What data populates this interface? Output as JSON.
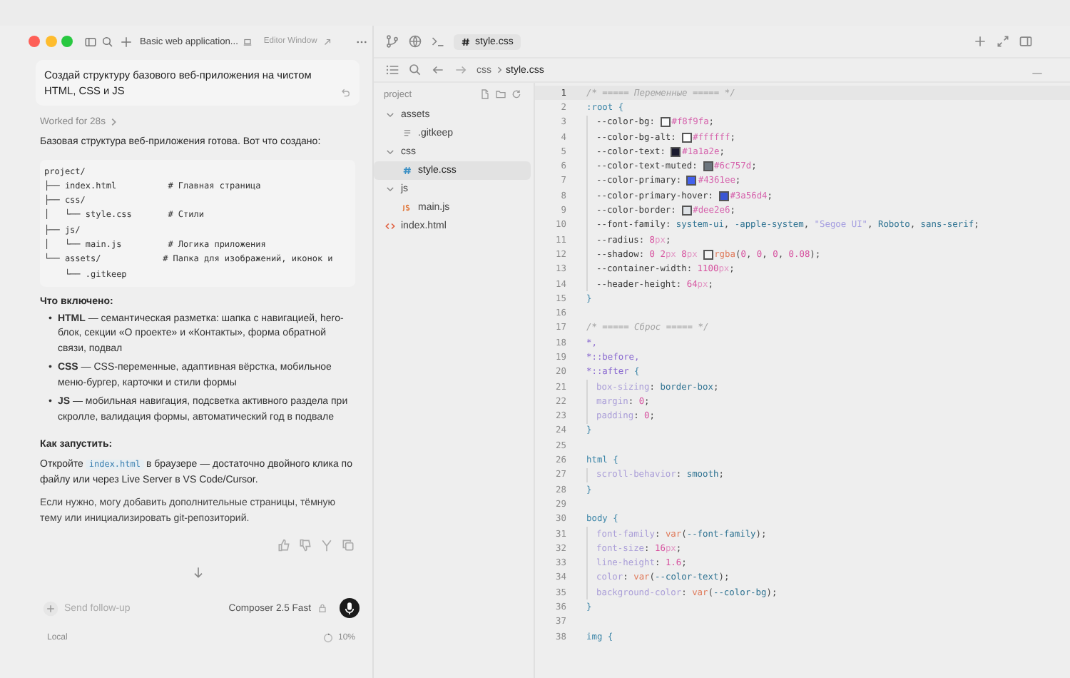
{
  "title_bar": {
    "title": "Basic web application...",
    "editor_window": "Editor Window"
  },
  "chat": {
    "user_message": "Создай структуру базового веб-приложения на чистом HTML, CSS и JS",
    "worked": "Worked for 28s",
    "intro": "Базовая структура веб-приложения готова. Вот что создано:",
    "code_block": [
      "project/",
      "├── index.html          # Главная страница",
      "├── css/",
      "│   └── style.css       # Стили",
      "├── js/",
      "│   └── main.js         # Логика приложения",
      "└── assets/            # Папка для изображений, иконок и",
      "    └── .gitkeep"
    ],
    "included_heading": "Что включено:",
    "bullets": [
      {
        "marker": "•",
        "text": "**HTML** — семантическая разметка: шапка с навигацией, hero-блок, секции «О проекте» и «Контакты», форма обратной связи, подвал"
      },
      {
        "marker": "•",
        "text": "**CSS** — CSS-переменные, адаптивная вёрстка, мобильное меню-бургер, карточки и стили формы"
      },
      {
        "marker": "•",
        "text": "**JS** — мобильная навигация, подсветка активного раздела при скролле, валидация формы, автоматический год в подвале"
      }
    ],
    "run_heading": "Как запустить:",
    "run_text": {
      "before": "Откройте",
      "code": "index.html",
      "after": "в браузере — достаточно двойного клика по файлу или через Live Server в VS Code/Cursor."
    },
    "closing": "Если нужно, могу добавить дополнительные страницы, тёмную тему или инициализировать git-репозиторий.",
    "input": {
      "placeholder": "Send follow-up"
    },
    "model": "Composer 2.5 Fast",
    "footer_left": "Local",
    "context": "10%"
  },
  "editor": {
    "tab": {
      "label": "style.css",
      "selected": true
    },
    "breadcrumb": [
      "css",
      "style.css"
    ],
    "file_tree": {
      "title": "project",
      "items": [
        {
          "label": "assets",
          "kind": "folder",
          "expanded": true,
          "selected": false,
          "children": [
            {
              "label": ".gitkeep",
              "kind": "text",
              "selected": false
            }
          ]
        },
        {
          "label": "css",
          "kind": "folder",
          "expanded": true,
          "selected": false,
          "children": [
            {
              "label": "style.css",
              "kind": "css",
              "selected": true
            }
          ]
        },
        {
          "label": "js",
          "kind": "folder",
          "expanded": true,
          "selected": false,
          "children": [
            {
              "label": "main.js",
              "kind": "js",
              "selected": false
            }
          ]
        },
        {
          "label": "index.html",
          "kind": "html",
          "selected": false
        }
      ]
    },
    "lines": [
      {
        "n": "1",
        "selected": true,
        "guide": false,
        "tokens": [
          {
            "kind": "comment",
            "text": "/* ===== Переменные ===== */"
          }
        ]
      },
      {
        "n": "2",
        "selected": false,
        "guide": false,
        "tokens": [
          {
            "kind": "tag",
            "text": ":root"
          },
          {
            "kind": "brace",
            "text": " {"
          }
        ]
      },
      {
        "n": "3",
        "selected": false,
        "guide": true,
        "tokens": [
          {
            "kind": "property",
            "text": "--color-bg"
          },
          {
            "kind": "punct",
            "text": ": "
          },
          {
            "kind": "swatch",
            "color": "#f8f9fa"
          },
          {
            "kind": "hex",
            "text": "#f8f9fa"
          },
          {
            "kind": "punct",
            "text": ";"
          }
        ]
      },
      {
        "n": "4",
        "selected": false,
        "guide": true,
        "tokens": [
          {
            "kind": "property",
            "text": "--color-bg-alt"
          },
          {
            "kind": "punct",
            "text": ": "
          },
          {
            "kind": "swatch",
            "color": "#ffffff"
          },
          {
            "kind": "hex",
            "text": "#ffffff"
          },
          {
            "kind": "punct",
            "text": ";"
          }
        ]
      },
      {
        "n": "5",
        "selected": false,
        "guide": true,
        "tokens": [
          {
            "kind": "property",
            "text": "--color-text"
          },
          {
            "kind": "punct",
            "text": ": "
          },
          {
            "kind": "swatch",
            "color": "#1a1a2e"
          },
          {
            "kind": "hex",
            "text": "#1a1a2e"
          },
          {
            "kind": "punct",
            "text": ";"
          }
        ]
      },
      {
        "n": "6",
        "selected": false,
        "guide": true,
        "tokens": [
          {
            "kind": "property",
            "text": "--color-text-muted"
          },
          {
            "kind": "punct",
            "text": ": "
          },
          {
            "kind": "swatch",
            "color": "#6c757d"
          },
          {
            "kind": "hex",
            "text": "#6c757d"
          },
          {
            "kind": "punct",
            "text": ";"
          }
        ]
      },
      {
        "n": "7",
        "selected": false,
        "guide": true,
        "tokens": [
          {
            "kind": "property",
            "text": "--color-primary"
          },
          {
            "kind": "punct",
            "text": ": "
          },
          {
            "kind": "swatch",
            "color": "#4361ee"
          },
          {
            "kind": "hex",
            "text": "#4361ee"
          },
          {
            "kind": "punct",
            "text": ";"
          }
        ]
      },
      {
        "n": "8",
        "selected": false,
        "guide": true,
        "tokens": [
          {
            "kind": "property",
            "text": "--color-primary-hover"
          },
          {
            "kind": "punct",
            "text": ": "
          },
          {
            "kind": "swatch",
            "color": "#3a56d4"
          },
          {
            "kind": "hex",
            "text": "#3a56d4"
          },
          {
            "kind": "punct",
            "text": ";"
          }
        ]
      },
      {
        "n": "9",
        "selected": false,
        "guide": true,
        "tokens": [
          {
            "kind": "property",
            "text": "--color-border"
          },
          {
            "kind": "punct",
            "text": ": "
          },
          {
            "kind": "swatch",
            "color": "#dee2e6"
          },
          {
            "kind": "hex",
            "text": "#dee2e6"
          },
          {
            "kind": "punct",
            "text": ";"
          }
        ]
      },
      {
        "n": "10",
        "selected": false,
        "guide": true,
        "tokens": [
          {
            "kind": "property",
            "text": "--font-family"
          },
          {
            "kind": "punct",
            "text": ": "
          },
          {
            "kind": "value",
            "text": "system-ui"
          },
          {
            "kind": "punct",
            "text": ", "
          },
          {
            "kind": "value",
            "text": "-apple-system"
          },
          {
            "kind": "punct",
            "text": ", "
          },
          {
            "kind": "string",
            "text": "\"Segoe UI\""
          },
          {
            "kind": "punct",
            "text": ", "
          },
          {
            "kind": "value",
            "text": "Roboto"
          },
          {
            "kind": "punct",
            "text": ", "
          },
          {
            "kind": "value",
            "text": "sans-serif"
          },
          {
            "kind": "punct",
            "text": ";"
          }
        ]
      },
      {
        "n": "11",
        "selected": false,
        "guide": true,
        "tokens": [
          {
            "kind": "property",
            "text": "--radius"
          },
          {
            "kind": "punct",
            "text": ": "
          },
          {
            "kind": "number",
            "text": "8"
          },
          {
            "kind": "unit",
            "text": "px"
          },
          {
            "kind": "punct",
            "text": ";"
          }
        ]
      },
      {
        "n": "12",
        "selected": false,
        "guide": true,
        "tokens": [
          {
            "kind": "property",
            "text": "--shadow"
          },
          {
            "kind": "punct",
            "text": ": "
          },
          {
            "kind": "number",
            "text": "0 2"
          },
          {
            "kind": "unit",
            "text": "px "
          },
          {
            "kind": "number",
            "text": "8"
          },
          {
            "kind": "unit",
            "text": "px "
          },
          {
            "kind": "swatch",
            "color": "#f4f4f4"
          },
          {
            "kind": "func",
            "text": "rgba"
          },
          {
            "kind": "punct",
            "text": "("
          },
          {
            "kind": "number",
            "text": "0"
          },
          {
            "kind": "punct",
            "text": ", "
          },
          {
            "kind": "number",
            "text": "0"
          },
          {
            "kind": "punct",
            "text": ", "
          },
          {
            "kind": "number",
            "text": "0"
          },
          {
            "kind": "punct",
            "text": ", "
          },
          {
            "kind": "number",
            "text": "0.08"
          },
          {
            "kind": "punct",
            "text": ");"
          }
        ]
      },
      {
        "n": "13",
        "selected": false,
        "guide": true,
        "tokens": [
          {
            "kind": "property",
            "text": "--container-width"
          },
          {
            "kind": "punct",
            "text": ": "
          },
          {
            "kind": "number",
            "text": "1100"
          },
          {
            "kind": "unit",
            "text": "px"
          },
          {
            "kind": "punct",
            "text": ";"
          }
        ]
      },
      {
        "n": "14",
        "selected": false,
        "guide": true,
        "tokens": [
          {
            "kind": "property",
            "text": "--header-height"
          },
          {
            "kind": "punct",
            "text": ": "
          },
          {
            "kind": "number",
            "text": "64"
          },
          {
            "kind": "unit",
            "text": "px"
          },
          {
            "kind": "punct",
            "text": ";"
          }
        ]
      },
      {
        "n": "15",
        "selected": false,
        "guide": false,
        "tokens": [
          {
            "kind": "brace",
            "text": "}"
          }
        ]
      },
      {
        "n": "16",
        "selected": false,
        "guide": false
      },
      {
        "n": "17",
        "selected": false,
        "guide": false,
        "tokens": [
          {
            "kind": "comment",
            "text": "/* ===== Сброс ===== */"
          }
        ]
      },
      {
        "n": "18",
        "selected": false,
        "guide": false,
        "tokens": [
          {
            "kind": "selector",
            "text": "*,"
          }
        ]
      },
      {
        "n": "19",
        "selected": false,
        "guide": false,
        "tokens": [
          {
            "kind": "selector",
            "text": "*::before,"
          }
        ]
      },
      {
        "n": "20",
        "selected": false,
        "guide": false,
        "tokens": [
          {
            "kind": "selector",
            "text": "*::after"
          },
          {
            "kind": "brace",
            "text": " {"
          }
        ]
      },
      {
        "n": "21",
        "selected": false,
        "guide": true,
        "tokens": [
          {
            "kind": "prop2",
            "text": "box-sizing"
          },
          {
            "kind": "punct",
            "text": ": "
          },
          {
            "kind": "value",
            "text": "border-box"
          },
          {
            "kind": "punct",
            "text": ";"
          }
        ]
      },
      {
        "n": "22",
        "selected": false,
        "guide": true,
        "tokens": [
          {
            "kind": "prop2",
            "text": "margin"
          },
          {
            "kind": "punct",
            "text": ": "
          },
          {
            "kind": "number",
            "text": "0"
          },
          {
            "kind": "punct",
            "text": ";"
          }
        ]
      },
      {
        "n": "23",
        "selected": false,
        "guide": true,
        "tokens": [
          {
            "kind": "prop2",
            "text": "padding"
          },
          {
            "kind": "punct",
            "text": ": "
          },
          {
            "kind": "number",
            "text": "0"
          },
          {
            "kind": "punct",
            "text": ";"
          }
        ]
      },
      {
        "n": "24",
        "selected": false,
        "guide": false,
        "tokens": [
          {
            "kind": "brace",
            "text": "}"
          }
        ]
      },
      {
        "n": "25",
        "selected": false,
        "guide": false
      },
      {
        "n": "26",
        "selected": false,
        "guide": false,
        "tokens": [
          {
            "kind": "tag",
            "text": "html"
          },
          {
            "kind": "brace",
            "text": " {"
          }
        ]
      },
      {
        "n": "27",
        "selected": false,
        "guide": true,
        "tokens": [
          {
            "kind": "prop2",
            "text": "scroll-behavior"
          },
          {
            "kind": "punct",
            "text": ": "
          },
          {
            "kind": "value",
            "text": "smooth"
          },
          {
            "kind": "punct",
            "text": ";"
          }
        ]
      },
      {
        "n": "28",
        "selected": false,
        "guide": false,
        "tokens": [
          {
            "kind": "brace",
            "text": "}"
          }
        ]
      },
      {
        "n": "29",
        "selected": false,
        "guide": false
      },
      {
        "n": "30",
        "selected": false,
        "guide": false,
        "tokens": [
          {
            "kind": "tag",
            "text": "body"
          },
          {
            "kind": "brace",
            "text": " {"
          }
        ]
      },
      {
        "n": "31",
        "selected": false,
        "guide": true,
        "tokens": [
          {
            "kind": "prop2",
            "text": "font-family"
          },
          {
            "kind": "punct",
            "text": ": "
          },
          {
            "kind": "func",
            "text": "var"
          },
          {
            "kind": "punct",
            "text": "("
          },
          {
            "kind": "value",
            "text": "--font-family"
          },
          {
            "kind": "punct",
            "text": ");"
          }
        ]
      },
      {
        "n": "32",
        "selected": false,
        "guide": true,
        "tokens": [
          {
            "kind": "prop2",
            "text": "font-size"
          },
          {
            "kind": "punct",
            "text": ": "
          },
          {
            "kind": "number",
            "text": "16"
          },
          {
            "kind": "unit",
            "text": "px"
          },
          {
            "kind": "punct",
            "text": ";"
          }
        ]
      },
      {
        "n": "33",
        "selected": false,
        "guide": true,
        "tokens": [
          {
            "kind": "prop2",
            "text": "line-height"
          },
          {
            "kind": "punct",
            "text": ": "
          },
          {
            "kind": "number",
            "text": "1.6"
          },
          {
            "kind": "punct",
            "text": ";"
          }
        ]
      },
      {
        "n": "34",
        "selected": false,
        "guide": true,
        "tokens": [
          {
            "kind": "prop2",
            "text": "color"
          },
          {
            "kind": "punct",
            "text": ": "
          },
          {
            "kind": "func",
            "text": "var"
          },
          {
            "kind": "punct",
            "text": "("
          },
          {
            "kind": "value",
            "text": "--color-text"
          },
          {
            "kind": "punct",
            "text": ");"
          }
        ]
      },
      {
        "n": "35",
        "selected": false,
        "guide": true,
        "tokens": [
          {
            "kind": "prop2",
            "text": "background-color"
          },
          {
            "kind": "punct",
            "text": ": "
          },
          {
            "kind": "func",
            "text": "var"
          },
          {
            "kind": "punct",
            "text": "("
          },
          {
            "kind": "value",
            "text": "--color-bg"
          },
          {
            "kind": "punct",
            "text": ");"
          }
        ]
      },
      {
        "n": "36",
        "selected": false,
        "guide": false,
        "tokens": [
          {
            "kind": "brace",
            "text": "}"
          }
        ]
      },
      {
        "n": "37",
        "selected": false,
        "guide": false
      },
      {
        "n": "38",
        "selected": false,
        "guide": false,
        "tokens": [
          {
            "kind": "tag",
            "text": "img"
          },
          {
            "kind": "brace",
            "text": " {"
          }
        ]
      }
    ]
  }
}
